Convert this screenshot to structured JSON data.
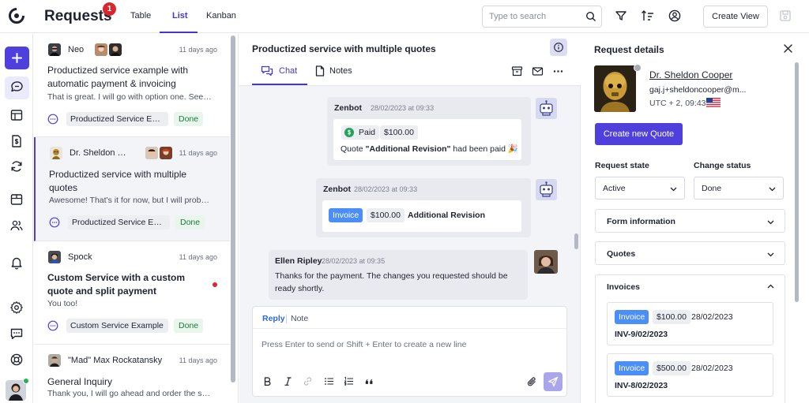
{
  "app": {
    "title": "Requests",
    "badge": "1",
    "views": [
      "Table",
      "List",
      "Kanban"
    ],
    "active_view": "List",
    "search_placeholder": "Type to search",
    "create_view_label": "Create View"
  },
  "requests": [
    {
      "name": "Neo",
      "time": "11 days ago",
      "title": "Productized service example with automatic payment & invoicing",
      "preview": "That is great. I will go with option one. See you soon",
      "service": "Productized Service Example",
      "status": "Done",
      "bold": false,
      "unread": false
    },
    {
      "name": "Dr. Sheldon Cooper",
      "time": "11 days ago",
      "title": "Productized service with multiple quotes",
      "preview": "Awesome! That's it for now, but I will probably come back soon",
      "service": "Productized Service Example",
      "status": "Done",
      "bold": false,
      "unread": false,
      "selected": true
    },
    {
      "name": "Spock",
      "time": "11 days ago",
      "title": "Custom Service with a custom quote and split payment",
      "preview": "You too!",
      "service": "Custom Service Example",
      "status": "Done",
      "bold": true,
      "unread": true
    },
    {
      "name": "\"Mad\" Max Rockatansky",
      "time": "11 days ago",
      "title": "General Inquiry",
      "preview": "Thank you, I will go ahead and order the service",
      "bold": false,
      "unread": false
    }
  ],
  "chat": {
    "title": "Productized service with multiple quotes",
    "tabs": [
      "Chat",
      "Notes"
    ],
    "messages": [
      {
        "sender": "Zenbot",
        "time": "28/02/2023 at 09:33",
        "paid_label": "Paid",
        "amount": "$100.00",
        "text_before": "Quote ",
        "text_bold": "\"Additional Revision\"",
        "text_after": " had been paid 🎉"
      },
      {
        "sender": "Zenbot",
        "time": "28/02/2023 at 09:33",
        "chip": "Invoice",
        "amount": "$100.00",
        "label": "Additional Revision"
      },
      {
        "sender": "Ellen Ripley",
        "time": "28/02/2023 at 09:35",
        "text": "Thanks for the payment. The changes you requested should be ready shortly."
      }
    ],
    "composer": {
      "reply_label": "Reply",
      "note_label": "Note",
      "placeholder": "Press Enter to send or Shift + Enter to create a new line"
    }
  },
  "details": {
    "title": "Request details",
    "contact": {
      "name": "Dr. Sheldon Cooper",
      "email": "gaj.j+sheldoncooper@m...",
      "timezone": "UTC + 2, 09:43"
    },
    "create_quote_label": "Create new Quote",
    "request_state_label": "Request state",
    "request_state_value": "Active",
    "change_status_label": "Change status",
    "change_status_value": "Done",
    "sections": [
      "Form information",
      "Quotes",
      "Invoices"
    ],
    "invoices": [
      {
        "chip": "Invoice",
        "amount": "$100.00",
        "date": "28/02/2023",
        "code": "INV-9/02/2023"
      },
      {
        "chip": "Invoice",
        "amount": "$500.00",
        "date": "28/02/2023",
        "code": "INV-8/02/2023"
      }
    ]
  },
  "colors": {
    "accent": "#4f3fdc",
    "invoice_chip": "#4c8ef7",
    "done_bg": "#e8f6ec",
    "badge": "#d9262c"
  },
  "icons": [
    "logo-icon",
    "plus-icon",
    "chat-icon",
    "table-icon",
    "document-dollar-icon",
    "refresh-icon",
    "box-icon",
    "users-icon",
    "bell-icon",
    "gear-icon",
    "message-square-icon",
    "help-buoy-icon",
    "search-icon",
    "filter-icon",
    "sort-icon",
    "user-circle-icon",
    "save-icon",
    "info-icon",
    "archive-icon",
    "mail-icon",
    "more-icon",
    "close-icon",
    "chevron-down-icon",
    "chevron-up-icon",
    "bold-icon",
    "italic-icon",
    "link-icon",
    "bullet-list-icon",
    "numbered-list-icon",
    "quote-icon",
    "paperclip-icon",
    "send-icon"
  ]
}
